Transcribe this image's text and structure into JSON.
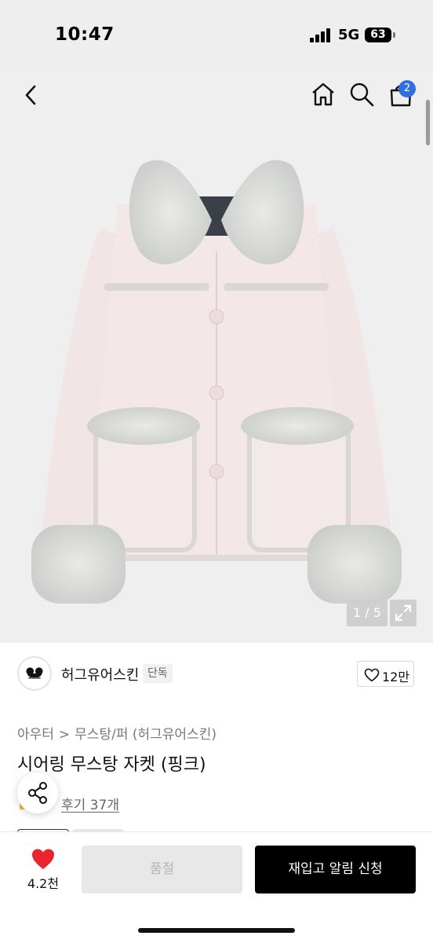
{
  "status_bar": {
    "time": "10:47",
    "network": "5G",
    "battery": "63"
  },
  "nav": {
    "cart_badge": "2"
  },
  "gallery": {
    "counter": "1 / 5"
  },
  "brand": {
    "name": "허그유어스킨",
    "badge": "단독",
    "likes": "12만"
  },
  "breadcrumb": [
    "아우터",
    "무스탕/퍼 (허그유어스킨)"
  ],
  "product": {
    "title": "시어링 무스탕 자켓 (핑크)",
    "reviews": "후기 37개"
  },
  "bottom_bar": {
    "wish_count": "4.2천",
    "soldout_label": "품절",
    "restock_label": "재입고 알림 신청"
  },
  "colors": {
    "accent_badge": "#2f6fe0",
    "heart": "#e8242f",
    "primary_button": "#000000"
  },
  "icons": [
    "back-chevron-icon",
    "home-icon",
    "search-icon",
    "cart-icon",
    "expand-icon",
    "heart-outline-icon",
    "share-icon",
    "heart-filled-icon"
  ]
}
